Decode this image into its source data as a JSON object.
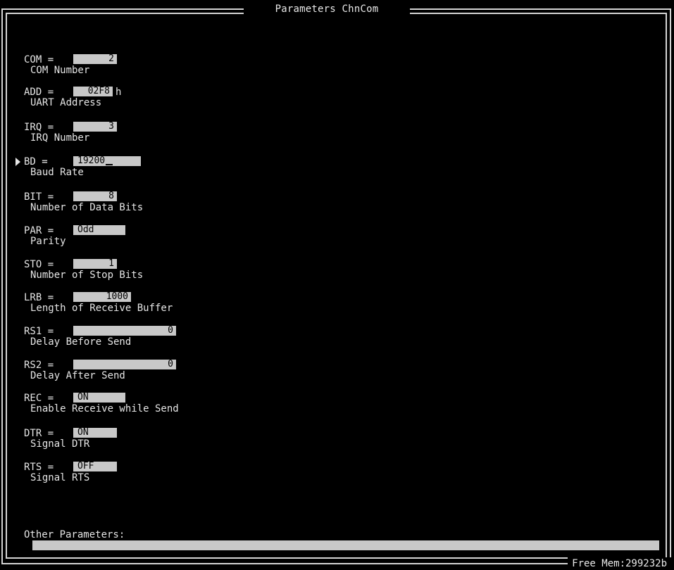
{
  "window": {
    "title": "Parameters ChnCom"
  },
  "params": [
    {
      "label": "COM =",
      "value": "2",
      "suffix": "",
      "desc": "COM Number"
    },
    {
      "label": "ADD =",
      "value": "02F8",
      "suffix": "h",
      "desc": "UART Address"
    },
    {
      "label": "IRQ =",
      "value": "3",
      "suffix": "",
      "desc": "IRQ Number"
    },
    {
      "label": "BD  =",
      "value": "19200",
      "suffix": "",
      "desc": "Baud Rate"
    },
    {
      "label": "BIT =",
      "value": "8",
      "suffix": "",
      "desc": "Number of Data Bits"
    },
    {
      "label": "PAR =",
      "value": "Odd",
      "suffix": "",
      "desc": "Parity"
    },
    {
      "label": "STO =",
      "value": "1",
      "suffix": "",
      "desc": "Number of Stop Bits"
    },
    {
      "label": "LRB =",
      "value": "1000",
      "suffix": "",
      "desc": "Length of Receive Buffer"
    },
    {
      "label": "RS1 =",
      "value": "0",
      "suffix": "",
      "desc": "Delay Before Send"
    },
    {
      "label": "RS2 =",
      "value": "0",
      "suffix": "",
      "desc": "Delay After Send"
    },
    {
      "label": "REC =",
      "value": "ON",
      "suffix": "",
      "desc": "Enable Receive while Send"
    },
    {
      "label": "DTR =",
      "value": "ON",
      "suffix": "",
      "desc": "Signal DTR"
    },
    {
      "label": "RTS =",
      "value": "OFF",
      "suffix": "",
      "desc": "Signal RTS"
    }
  ],
  "other": {
    "label": "Other Parameters:",
    "value": ""
  },
  "status": {
    "free_mem": "Free Mem:299232b"
  },
  "colors": {
    "background": "#000000",
    "text": "#e6e6e6",
    "field": "#c8c8c8",
    "field_text": "#000000",
    "frame": "#d4d4d4"
  },
  "icons": {
    "selected_row_marker": "cursor-triangle-icon"
  }
}
